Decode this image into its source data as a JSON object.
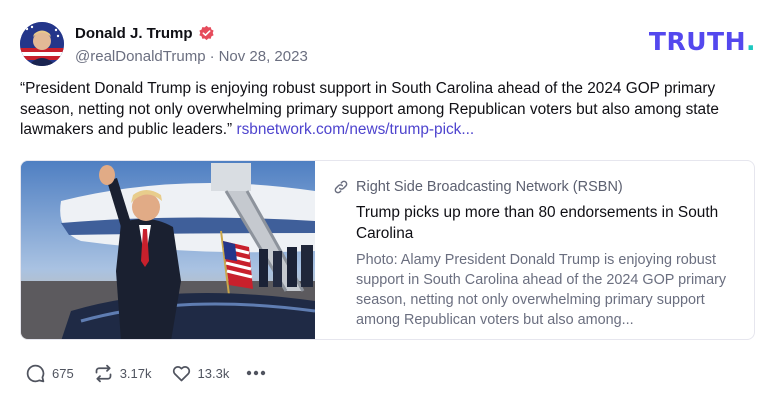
{
  "brand": {
    "logo_text": "TRUTH",
    "logo_dot": ".",
    "accent": "#5448ee",
    "dot_color": "#1cc8c0"
  },
  "author": {
    "name": "Donald J. Trump",
    "handle": "@realDonaldTrump",
    "separator": "·",
    "date": "Nov 28, 2023",
    "verified_icon": "verified-badge-icon"
  },
  "post": {
    "text": "“President Donald Trump is enjoying robust support in South Carolina ahead of the 2024 GOP primary season, netting not only overwhelming primary support among Republican voters but also among state lawmakers and public leaders.”",
    "link_text": "rsbnetwork.com/news/trump-pick..."
  },
  "card": {
    "source": "Right Side Broadcasting Network (RSBN)",
    "title": "Trump picks up more than 80 endorsements in South Carolina",
    "description": "Photo: Alamy President Donald Trump is enjoying robust support in South Carolina ahead of the 2024 GOP primary season, netting not only overwhelming primary support among Republican voters but also among..."
  },
  "actions": {
    "replies": "675",
    "retruths": "3.17k",
    "likes": "13.3k",
    "more_icon": "more-options-icon"
  }
}
